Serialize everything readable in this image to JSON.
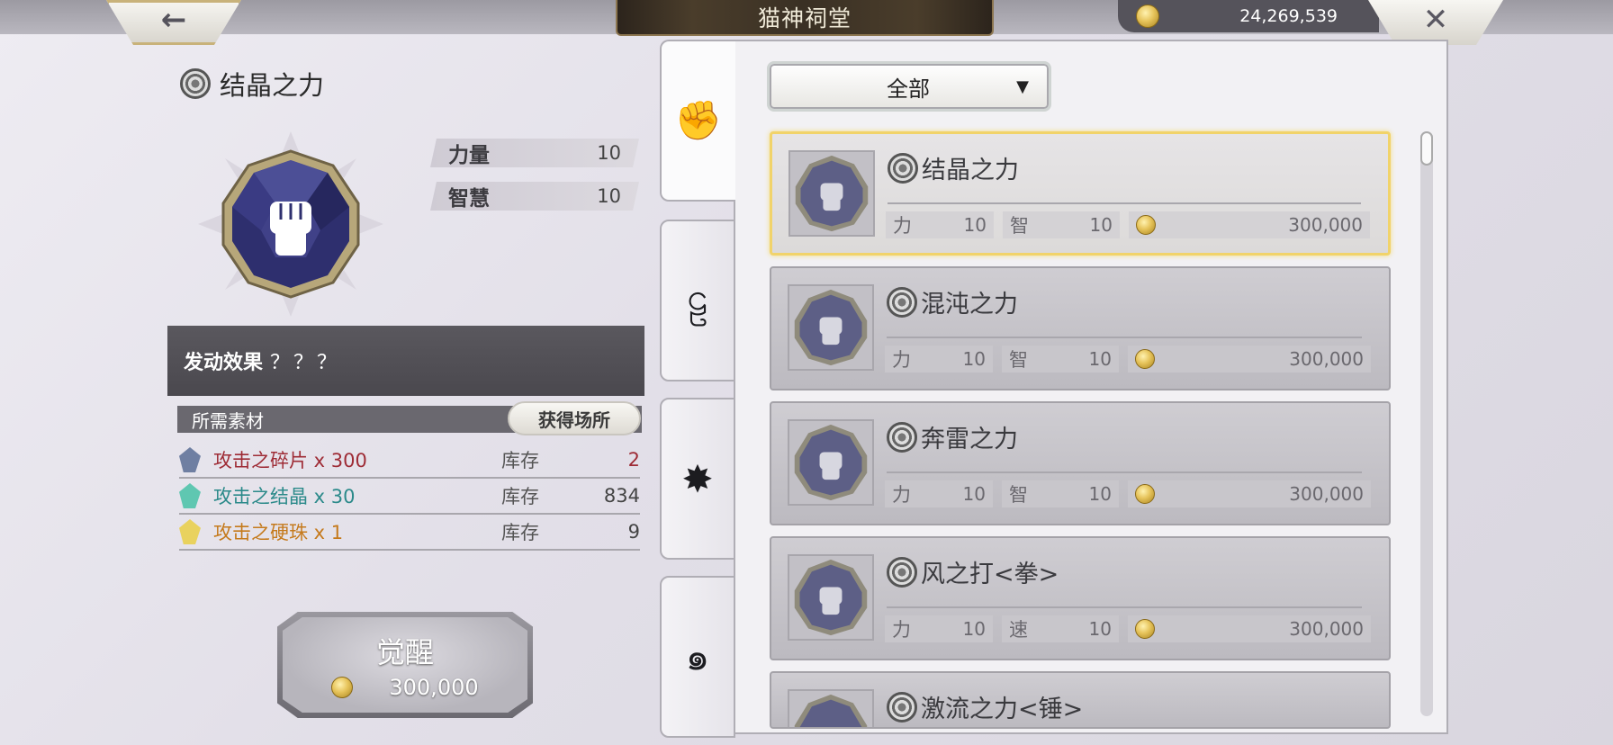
{
  "header": {
    "back_icon": "←",
    "title": "猫神祠堂",
    "gold": "24,269,539",
    "close_icon": "✕"
  },
  "selected": {
    "name": "结晶之力",
    "stats": [
      {
        "label": "力量",
        "value": "10"
      },
      {
        "label": "智慧",
        "value": "10"
      }
    ],
    "effect_label": "发动效果",
    "effect_value": "？？？"
  },
  "materials": {
    "header": "所需素材",
    "obtain_button": "获得场所",
    "items": [
      {
        "name": "攻击之碎片 x 300",
        "stock_label": "库存",
        "stock": "2",
        "color": "#9e2b35",
        "shard": "#6f7fa2"
      },
      {
        "name": "攻击之结晶 x 30",
        "stock_label": "库存",
        "stock": "834",
        "color": "#2b8a8a",
        "shard": "#5fc7b1"
      },
      {
        "name": "攻击之硬珠 x 1",
        "stock_label": "库存",
        "stock": "9",
        "color": "#c57a1c",
        "shard": "#e9d25e"
      }
    ]
  },
  "awaken": {
    "label": "觉醒",
    "cost": "300,000"
  },
  "tabs": [
    {
      "icon": "fist-icon",
      "glyph": "✊"
    },
    {
      "icon": "swirl-icon",
      "glyph": "ဠ"
    },
    {
      "icon": "star-burst-icon",
      "glyph": "✸"
    },
    {
      "icon": "spiral-icon",
      "glyph": "๑"
    }
  ],
  "filter": {
    "value": "全部",
    "arrow": "▼"
  },
  "list": [
    {
      "name": "结晶之力",
      "s1k": "力",
      "s1v": "10",
      "s2k": "智",
      "s2v": "10",
      "cost": "300,000"
    },
    {
      "name": "混沌之力",
      "s1k": "力",
      "s1v": "10",
      "s2k": "智",
      "s2v": "10",
      "cost": "300,000"
    },
    {
      "name": "奔雷之力",
      "s1k": "力",
      "s1v": "10",
      "s2k": "智",
      "s2v": "10",
      "cost": "300,000"
    },
    {
      "name": "风之打<拳>",
      "s1k": "力",
      "s1v": "10",
      "s2k": "速",
      "s2v": "10",
      "cost": "300,000"
    },
    {
      "name": "激流之力<锤>"
    }
  ],
  "colors": {
    "selected_border": "#f1d36a",
    "gem": "#2e2f6e"
  }
}
